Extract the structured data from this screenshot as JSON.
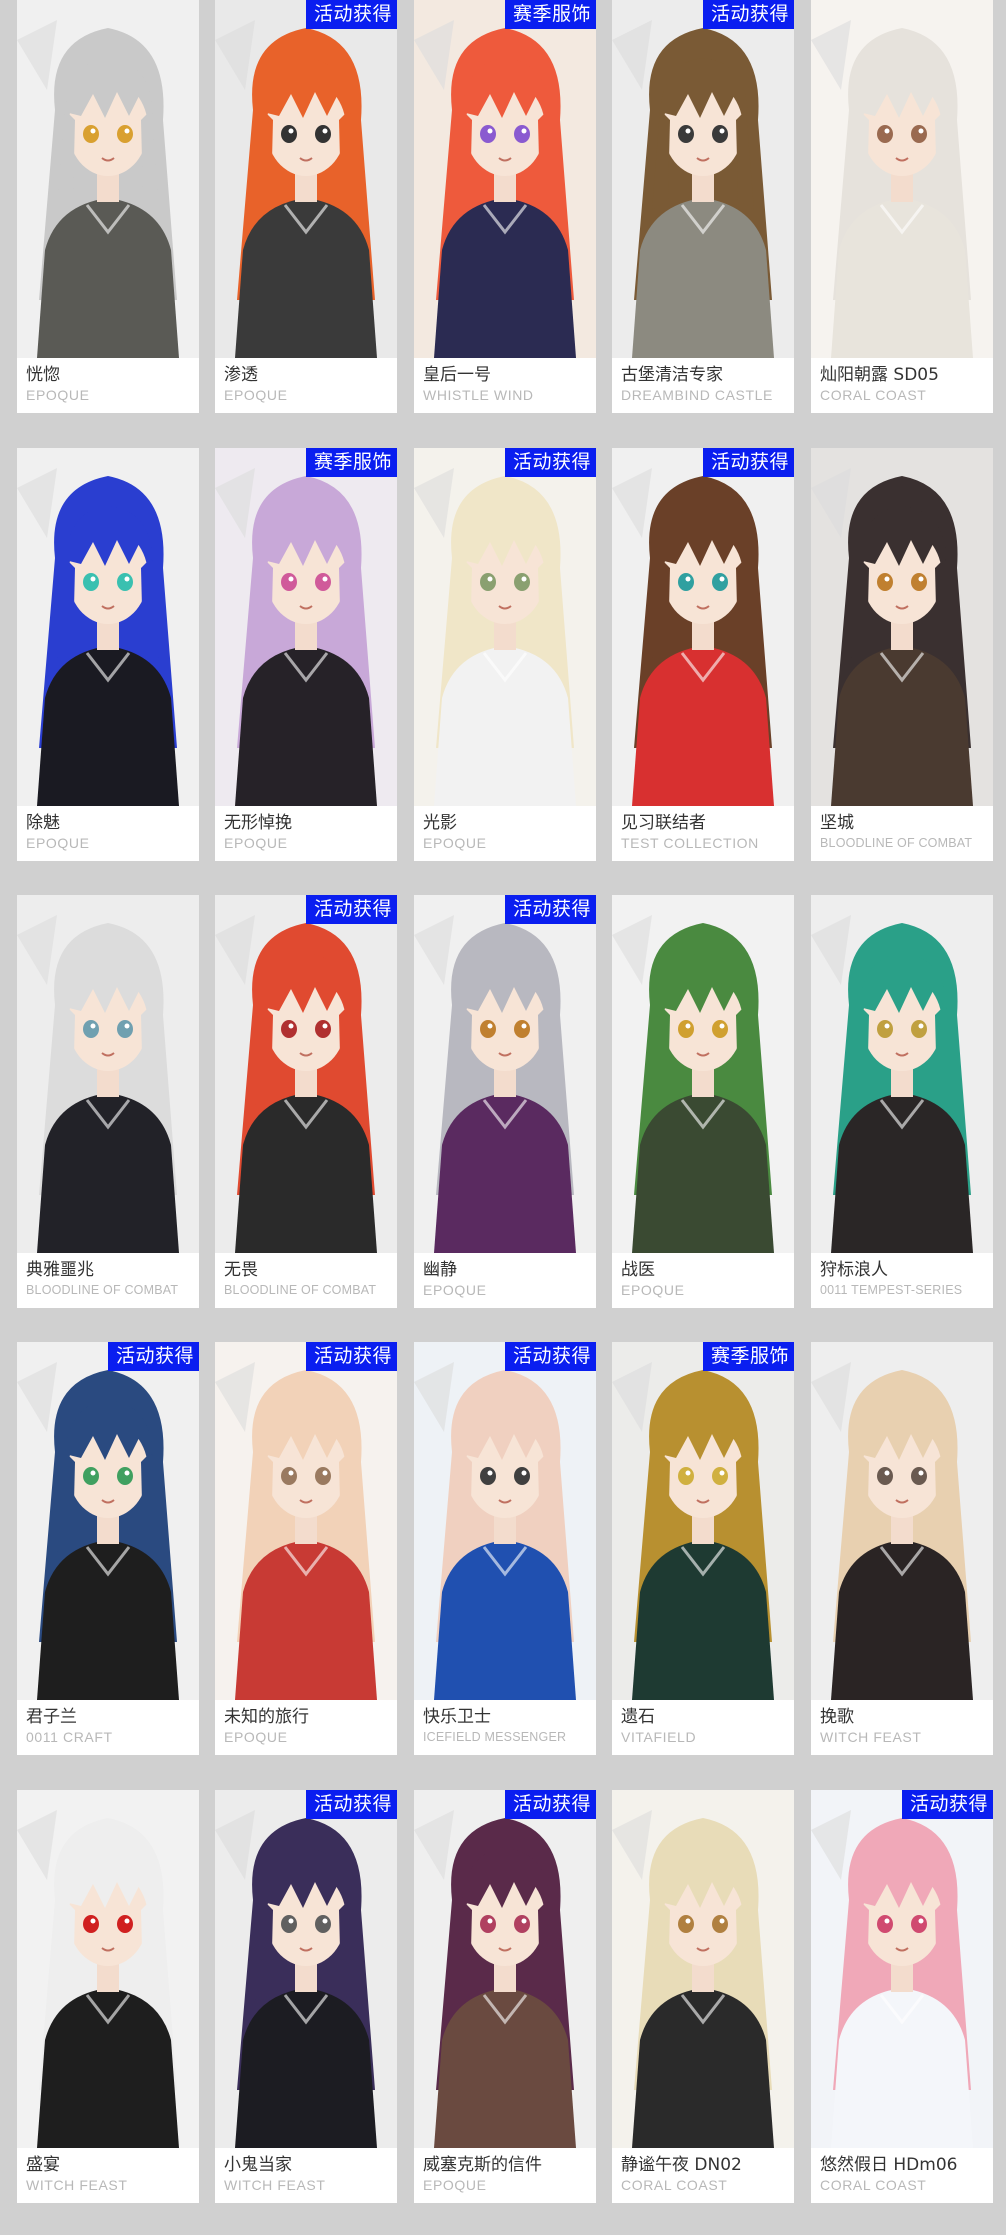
{
  "colors": {
    "background": "#d0d0d0",
    "card": "#ffffff",
    "badge": "#0a1ef0",
    "name": "#333333",
    "series": "#b8b8b8"
  },
  "cards": [
    {
      "name": "恍惚",
      "series": "EPOQUE",
      "badge": "",
      "hair": "#c9c9c9",
      "bg": "#f0f0f0",
      "outfit": "#5a5a55",
      "eye": "#d9a030"
    },
    {
      "name": "渗透",
      "series": "EPOQUE",
      "badge": "活动获得",
      "hair": "#e8622a",
      "bg": "#e9e9e9",
      "outfit": "#3a3a3a",
      "eye": "#333333"
    },
    {
      "name": "皇后一号",
      "series": "WHISTLE WIND",
      "badge": "赛季服饰",
      "hair": "#ee5a3c",
      "bg": "#f3e9e0",
      "outfit": "#2b2b52",
      "eye": "#8a5ad0"
    },
    {
      "name": "古堡清洁专家",
      "series": "DREAMBIND CASTLE",
      "badge": "活动获得",
      "hair": "#7a5a35",
      "bg": "#ececec",
      "outfit": "#8c8a80",
      "eye": "#3a3a3a"
    },
    {
      "name": "灿阳朝露 SD05",
      "series": "CORAL COAST",
      "badge": "",
      "hair": "#e6e2dc",
      "bg": "#f6f3ef",
      "outfit": "#e8e4dc",
      "eye": "#9a6a50"
    },
    {
      "name": "除魅",
      "series": "EPOQUE",
      "badge": "",
      "hair": "#2a3ed0",
      "bg": "#f0f0f0",
      "outfit": "#1a1a22",
      "eye": "#3ac0b0"
    },
    {
      "name": "无形悼挽",
      "series": "EPOQUE",
      "badge": "赛季服饰",
      "hair": "#c8a8d8",
      "bg": "#eeeaf0",
      "outfit": "#262228",
      "eye": "#d05a9a"
    },
    {
      "name": "光影",
      "series": "EPOQUE",
      "badge": "活动获得",
      "hair": "#f0e6c8",
      "bg": "#f4f2ec",
      "outfit": "#f2f2f2",
      "eye": "#8aa070"
    },
    {
      "name": "见习联结者",
      "series": "TEST COLLECTION",
      "badge": "活动获得",
      "hair": "#6a4028",
      "bg": "#f0f0f0",
      "outfit": "#d83030",
      "eye": "#30a0a0"
    },
    {
      "name": "坚城",
      "series": "BLOODLINE OF COMBAT",
      "badge": "",
      "hair": "#3a3030",
      "bg": "#e4e2e0",
      "outfit": "#4a3a30",
      "eye": "#c08030"
    },
    {
      "name": "典雅噩兆",
      "series": "BLOODLINE OF COMBAT",
      "badge": "",
      "hair": "#dcdcdc",
      "bg": "#ededed",
      "outfit": "#222228",
      "eye": "#70a0b0"
    },
    {
      "name": "无畏",
      "series": "BLOODLINE OF COMBAT",
      "badge": "活动获得",
      "hair": "#e04a30",
      "bg": "#ececec",
      "outfit": "#2a2a2a",
      "eye": "#b03030"
    },
    {
      "name": "幽静",
      "series": "EPOQUE",
      "badge": "活动获得",
      "hair": "#b8b8c0",
      "bg": "#f0f0f0",
      "outfit": "#5a2a60",
      "eye": "#c08030"
    },
    {
      "name": "战医",
      "series": "EPOQUE",
      "badge": "",
      "hair": "#4a8a40",
      "bg": "#f2f2f2",
      "outfit": "#3a4a32",
      "eye": "#d0a030"
    },
    {
      "name": "狩标浪人",
      "series": "0011 TEMPEST-SERIES",
      "badge": "",
      "hair": "#2aa088",
      "bg": "#eeeeee",
      "outfit": "#2a2626",
      "eye": "#c0a040"
    },
    {
      "name": "君子兰",
      "series": "0011 CRAFT",
      "badge": "活动获得",
      "hair": "#2a4a80",
      "bg": "#f0f0f0",
      "outfit": "#1e1e1e",
      "eye": "#40a060"
    },
    {
      "name": "未知的旅行",
      "series": "EPOQUE",
      "badge": "活动获得",
      "hair": "#f2d2b8",
      "bg": "#f6f2ee",
      "outfit": "#c83a34",
      "eye": "#9a7a60"
    },
    {
      "name": "快乐卫士",
      "series": "ICEFIELD MESSENGER",
      "badge": "活动获得",
      "hair": "#f0d0c0",
      "bg": "#eef2f6",
      "outfit": "#2050b0",
      "eye": "#404040"
    },
    {
      "name": "遗石",
      "series": "VITAFIELD",
      "badge": "赛季服饰",
      "hair": "#b89030",
      "bg": "#ececea",
      "outfit": "#1e3a32",
      "eye": "#d0b040"
    },
    {
      "name": "挽歌",
      "series": "WITCH FEAST",
      "badge": "",
      "hair": "#e8d0b0",
      "bg": "#eeeeee",
      "outfit": "#2a2424",
      "eye": "#6a5a50"
    },
    {
      "name": "盛宴",
      "series": "WITCH FEAST",
      "badge": "",
      "hair": "#eeeeee",
      "bg": "#f2f2f2",
      "outfit": "#1e1e1e",
      "eye": "#d02020"
    },
    {
      "name": "小鬼当家",
      "series": "WITCH FEAST",
      "badge": "活动获得",
      "hair": "#3a2e5a",
      "bg": "#ececec",
      "outfit": "#1c1c22",
      "eye": "#606060"
    },
    {
      "name": "威塞克斯的信件",
      "series": "EPOQUE",
      "badge": "活动获得",
      "hair": "#5a2a4a",
      "bg": "#efefef",
      "outfit": "#6a4a40",
      "eye": "#b04060"
    },
    {
      "name": "静谧午夜 DN02",
      "series": "CORAL COAST",
      "badge": "",
      "hair": "#e8dcb8",
      "bg": "#f4f2ec",
      "outfit": "#2a2a2a",
      "eye": "#b08040"
    },
    {
      "name": "悠然假日 HDm06",
      "series": "CORAL COAST",
      "badge": "活动获得",
      "hair": "#f0a8b8",
      "bg": "#f2f4f8",
      "outfit": "#f4f6fa",
      "eye": "#d04a70"
    }
  ]
}
